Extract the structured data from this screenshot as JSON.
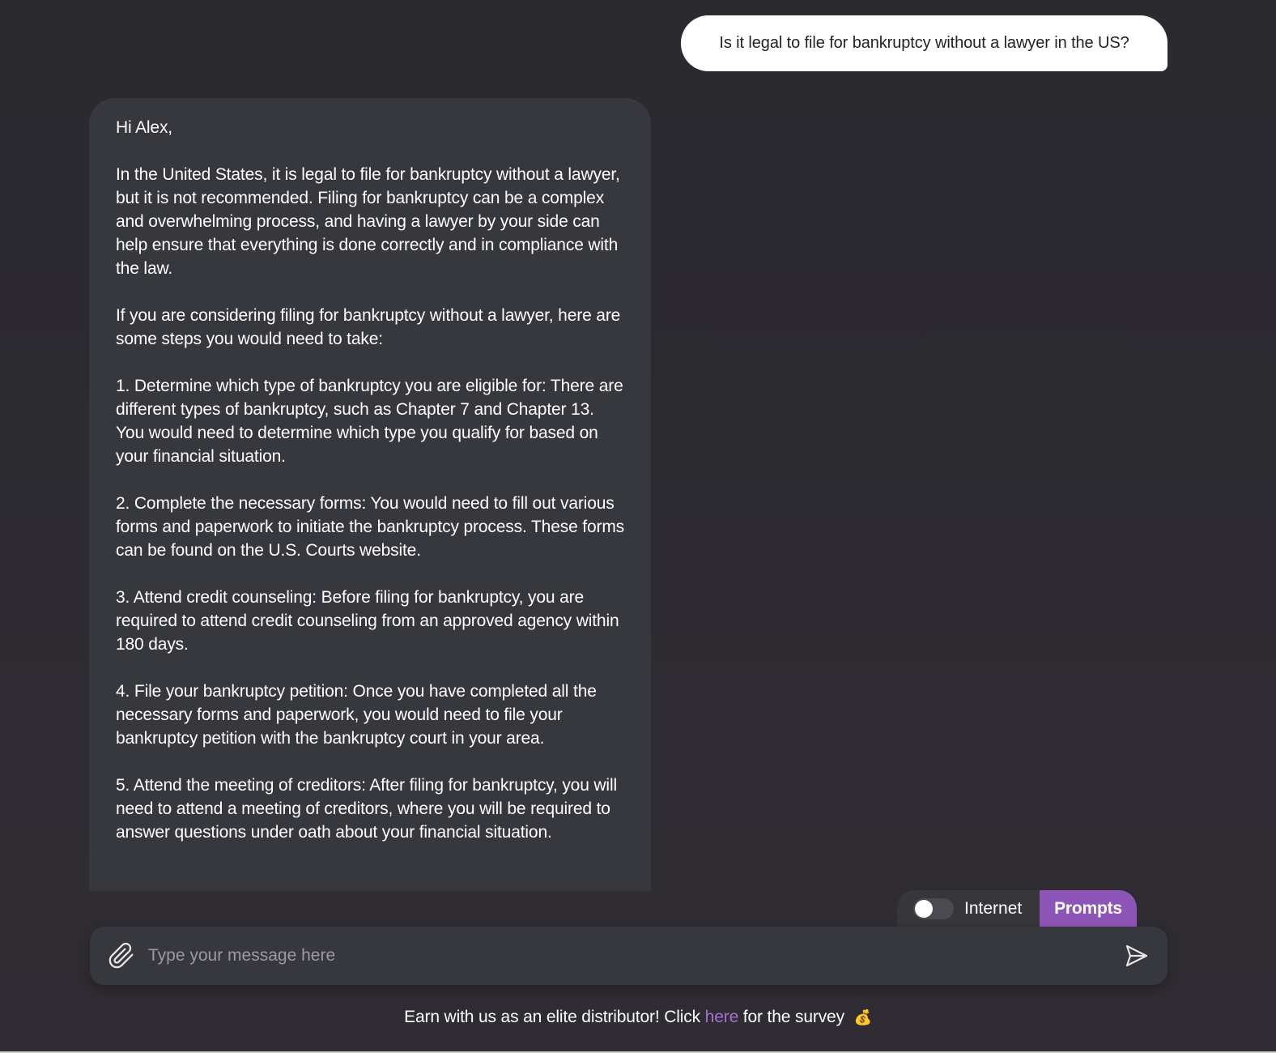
{
  "conversation": {
    "user_message": "Is it legal to file for bankruptcy without a lawyer in the US?",
    "assistant_paragraphs": [
      "Hi Alex,",
      "In the United States, it is legal to file for bankruptcy without a lawyer, but it is not recommended. Filing for bankruptcy can be a complex and overwhelming process, and having a lawyer by your side can help ensure that everything is done correctly and in compliance with the law.",
      "If you are considering filing for bankruptcy without a lawyer, here are some steps you would need to take:",
      "1. Determine which type of bankruptcy you are eligible for: There are different types of bankruptcy, such as Chapter 7 and Chapter 13. You would need to determine which type you qualify for based on your financial situation.",
      "2. Complete the necessary forms: You would need to fill out various forms and paperwork to initiate the bankruptcy process. These forms can be found on the U.S. Courts website.",
      "3. Attend credit counseling: Before filing for bankruptcy, you are required to attend credit counseling from an approved agency within 180 days.",
      "4. File your bankruptcy petition: Once you have completed all the necessary forms and paperwork, you would need to file your bankruptcy petition with the bankruptcy court in your area.",
      "5. Attend the meeting of creditors: After filing for bankruptcy, you will need to attend a meeting of creditors, where you will be required to answer questions under oath about your financial situation."
    ]
  },
  "toolbar": {
    "internet_label": "Internet",
    "internet_enabled": false,
    "prompts_label": "Prompts"
  },
  "composer": {
    "placeholder": "Type your message here",
    "attach_icon": "paperclip-icon",
    "send_icon": "send-icon"
  },
  "footer": {
    "text_before": "Earn with us as an elite distributor! Click",
    "link_text": "here",
    "text_after": "for the survey",
    "emoji": "💰"
  },
  "colors": {
    "background": "#2b2a30",
    "bubble_bot": "#37383d",
    "bubble_user": "#ffffff",
    "accent": "#8e55b8",
    "link": "#a66fd1"
  }
}
